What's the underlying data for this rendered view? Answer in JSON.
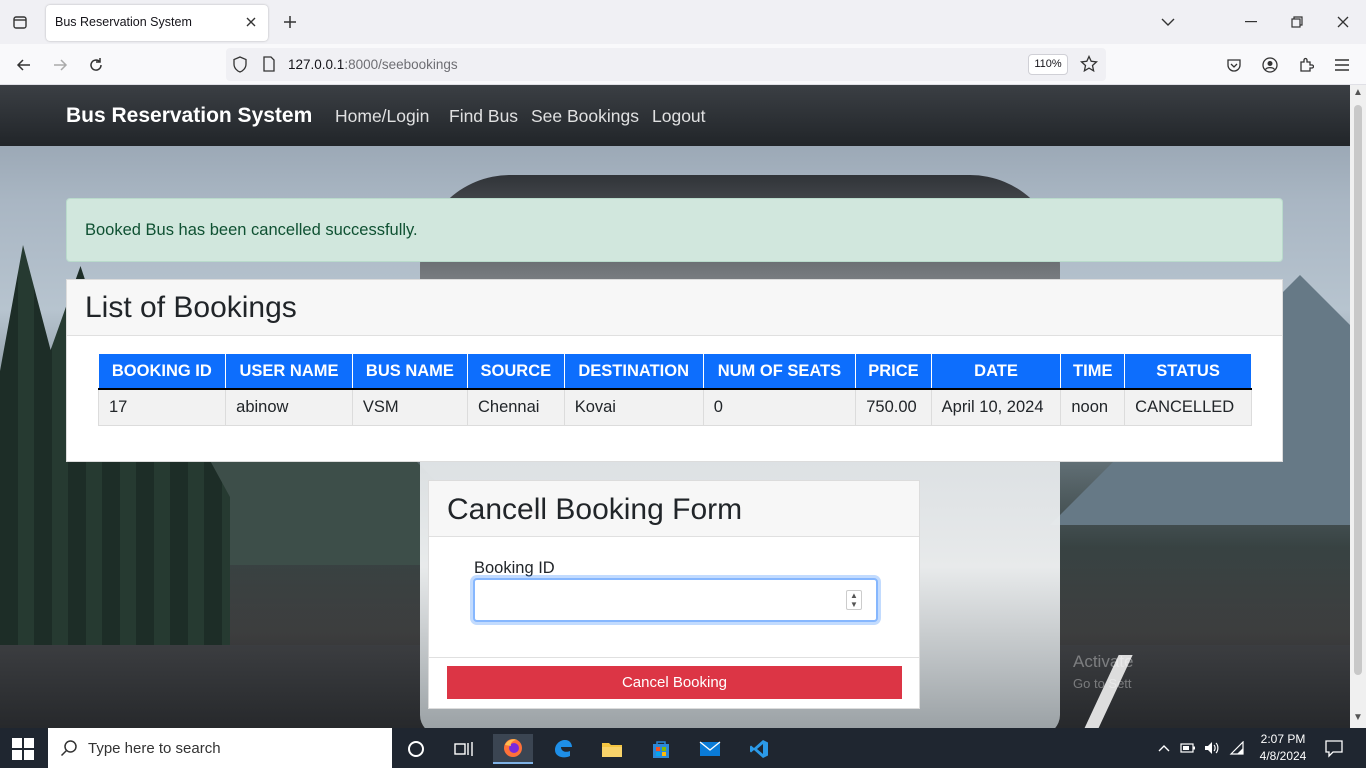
{
  "browser": {
    "tab_title": "Bus Reservation System",
    "url_host": "127.0.0.1",
    "url_path": ":8000/seebookings",
    "zoom": "110%"
  },
  "site": {
    "brand": "Bus Reservation System",
    "nav": [
      "Home/Login",
      "Find Bus",
      "See Bookings",
      "Logout"
    ]
  },
  "alert": {
    "message": "Booked Bus has been cancelled successfully."
  },
  "bookings": {
    "title": "List of Bookings",
    "columns": [
      "BOOKING ID",
      "USER NAME",
      "BUS NAME",
      "SOURCE",
      "DESTINATION",
      "NUM OF SEATS",
      "PRICE",
      "DATE",
      "TIME",
      "STATUS"
    ],
    "rows": [
      [
        "17",
        "abinow",
        "VSM",
        "Chennai",
        "Kovai",
        "0",
        "750.00",
        "April 10, 2024",
        "noon",
        "CANCELLED"
      ]
    ],
    "header_color": "#0d6efd"
  },
  "cancel_form": {
    "title": "Cancell Booking Form",
    "field_label": "Booking ID",
    "field_value": "",
    "button_label": "Cancel Booking",
    "button_color": "#dc3545"
  },
  "watermark": {
    "line1": "Activate",
    "line2": "Go to Sett"
  },
  "taskbar": {
    "search_placeholder": "Type here to search",
    "time": "2:07 PM",
    "date": "4/8/2024",
    "apps": [
      "task-view-icon",
      "firefox-icon",
      "edge-icon",
      "file-explorer-icon",
      "store-icon",
      "mail-icon",
      "vscode-icon"
    ]
  }
}
